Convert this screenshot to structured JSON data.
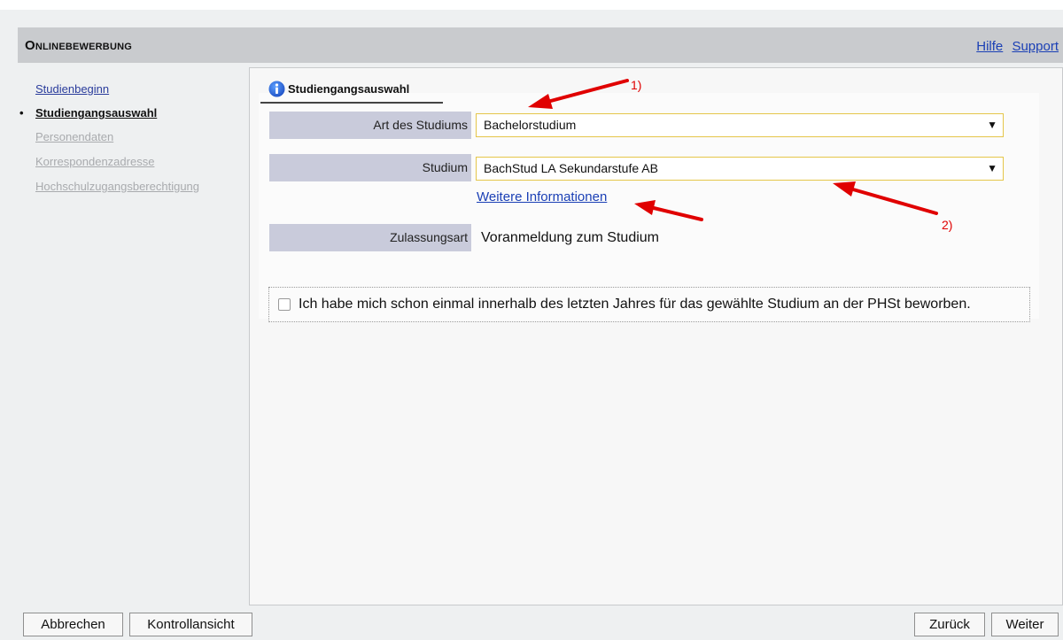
{
  "header": {
    "title": "Onlinebewerbung",
    "links": {
      "help": "Hilfe",
      "support": "Support"
    }
  },
  "sidebar": {
    "items": [
      {
        "label": "Studienbeginn",
        "state": "link"
      },
      {
        "label": "Studiengangsauswahl",
        "state": "active"
      },
      {
        "label": "Personendaten",
        "state": "disabled"
      },
      {
        "label": "Korrespondenzadresse",
        "state": "disabled"
      },
      {
        "label": "Hochschulzugangsberechtigung",
        "state": "disabled"
      }
    ]
  },
  "tab": {
    "label": "Studiengangsauswahl",
    "icon": "info-icon"
  },
  "form": {
    "art_label": "Art des Studiums",
    "art_value": "Bachelorstudium",
    "studium_label": "Studium",
    "studium_value": "BachStud LA Sekundarstufe AB",
    "more_info": "Weitere Informationen",
    "zulassung_label": "Zulassungsart",
    "zulassung_value": "Voranmeldung zum Studium",
    "checkbox_label": "Ich habe mich schon einmal innerhalb des letzten Jahres für das gewählte Studium an der PHSt beworben.",
    "checkbox_checked": false
  },
  "annotations": {
    "first": "1)",
    "second": "2)"
  },
  "buttons": {
    "cancel": "Abbrechen",
    "review": "Kontrollansicht",
    "back": "Zurück",
    "next": "Weiter"
  },
  "colors": {
    "header_bg": "#c9cbce",
    "label_bg": "#c9cbdb",
    "select_border": "#e5c64a",
    "link": "#1a3fb5",
    "annotation": "#e00000"
  }
}
